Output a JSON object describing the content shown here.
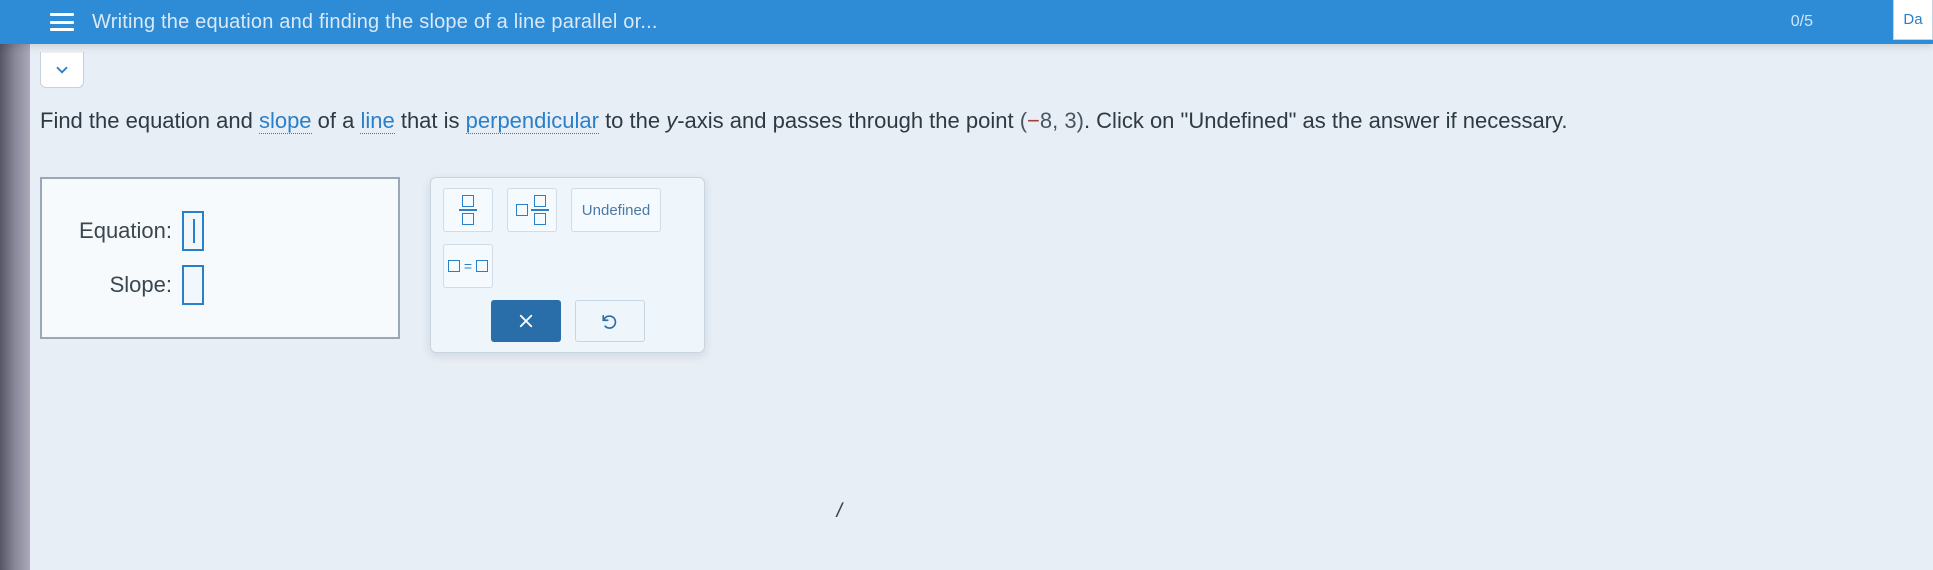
{
  "header": {
    "title": "Writing the equation and finding the slope of a line parallel or...",
    "progress": "0/5",
    "right_stub": "Da"
  },
  "question": {
    "pre1": "Find the equation and ",
    "term_slope": "slope",
    "mid1": " of a ",
    "term_line": "line",
    "mid2": " that is ",
    "term_perpendicular": "perpendicular",
    "mid3": " to the ",
    "yaxis_y": "y",
    "yaxis_rest": "-axis and passes through the point ",
    "point_open": "(",
    "point_neg": "−",
    "point_x": "8",
    "point_sep": ", ",
    "point_y": "3",
    "point_close": ")",
    "tail": ". Click on \"Undefined\" as the answer if necessary."
  },
  "fields": {
    "equation_label": "Equation:",
    "slope_label": "Slope:",
    "equation_value": "",
    "slope_value": ""
  },
  "palette": {
    "fraction_name": "fraction",
    "mixed_name": "mixed-number",
    "undefined_label": "Undefined",
    "equation_name": "equation-template",
    "equation_text": "="
  },
  "actions": {
    "clear_aria": "Clear",
    "reset_aria": "Reset"
  }
}
